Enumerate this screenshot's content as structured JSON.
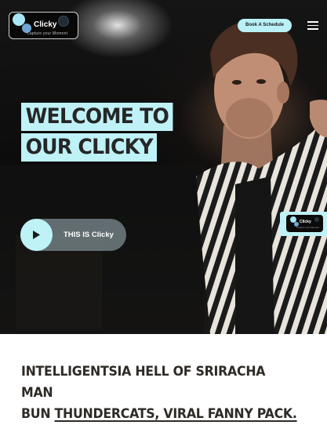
{
  "header": {
    "logo": {
      "name": "Clicky",
      "tagline": "Capture your Moment"
    },
    "book_button": "Book A Schedule",
    "menu_icon": "hamburger-menu-icon"
  },
  "hero": {
    "welcome_line1": "WELCOME TO",
    "welcome_line2": "OUR CLICKY",
    "play_button_label": "THIS IS Clicky",
    "play_icon": "play-icon",
    "side_badge": {
      "name": "Clicky",
      "tagline": "Capture your Moment"
    }
  },
  "intro": {
    "line1": "INTELLIGENTSIA HELL OF SRIRACHA MAN",
    "line2_prefix": "BUN ",
    "line2_link": "THUNDERCATS, VIRAL FANNY PACK."
  },
  "colors": {
    "accent": "#bff2f7",
    "dark_text": "#262626",
    "hero_background": "#0b0b0b"
  }
}
